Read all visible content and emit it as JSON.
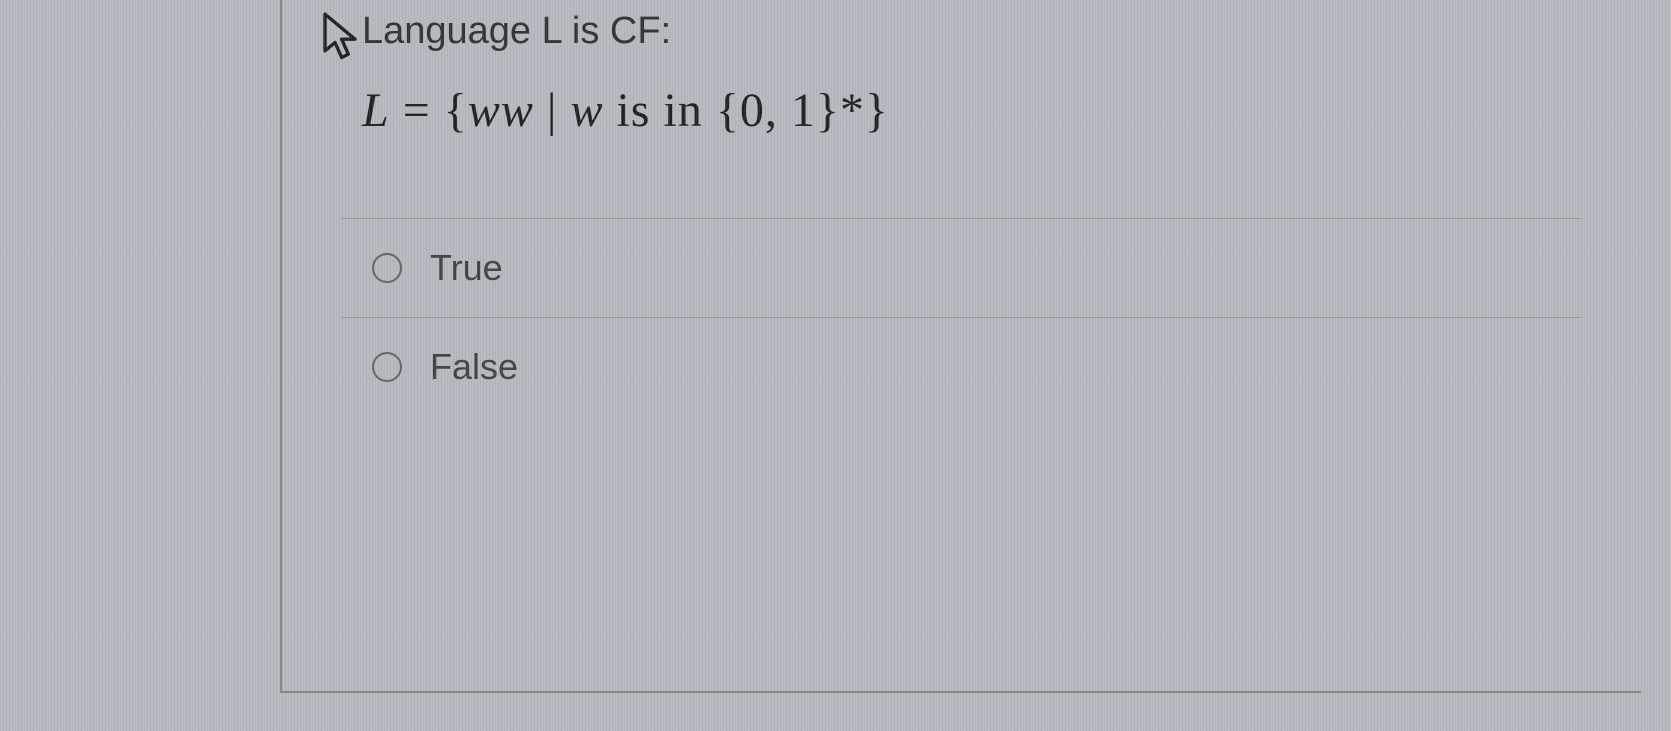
{
  "question": {
    "prompt": "Language L is CF:",
    "expression_parts": {
      "L": "L",
      "eq": " = {",
      "ww": "ww",
      "mid": " | ",
      "w": "w",
      "isin": " is in ",
      "set": "{0, 1}*",
      "close": "}"
    }
  },
  "options": [
    {
      "label": "True"
    },
    {
      "label": "False"
    }
  ]
}
